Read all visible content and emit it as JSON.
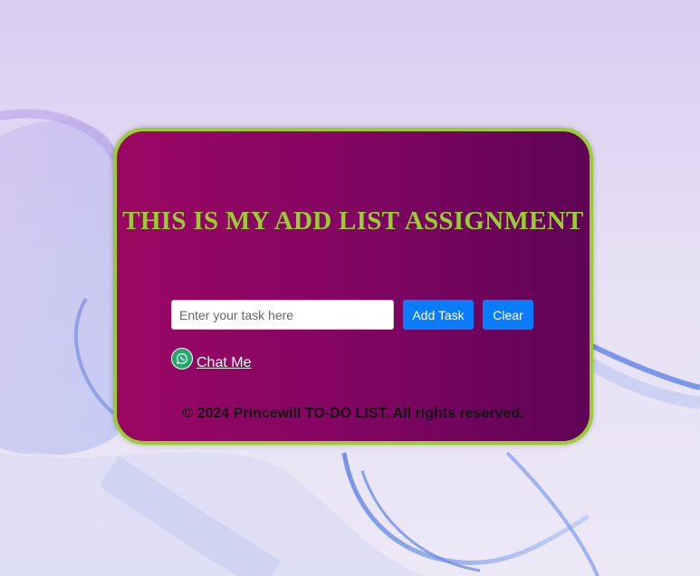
{
  "card": {
    "title": "THIS IS MY ADD LIST ASSIGNMENT",
    "task_input": {
      "value": "",
      "placeholder": "Enter your task here"
    },
    "add_button_label": "Add Task",
    "clear_button_label": "Clear",
    "chat_link": {
      "icon": "whatsapp-icon",
      "label": "Chat Me"
    },
    "footer_text": "© 2024 Princewill TO-DO LIST. All rights reserved."
  },
  "colors": {
    "accent_green": "#9acd32",
    "button_blue": "#0a7cff",
    "card_gradient_start": "#9b0763",
    "card_gradient_end": "#5f0457",
    "whatsapp_green": "#25a66a"
  }
}
